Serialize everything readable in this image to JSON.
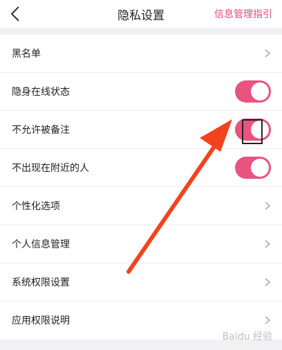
{
  "header": {
    "title": "隐私设置",
    "right_link": "信息管理指引"
  },
  "colors": {
    "accent": "#e9537f",
    "link": "#e3497f",
    "annotation_arrow": "#f2431e"
  },
  "settings": [
    {
      "label": "黑名单",
      "control": "chevron"
    },
    {
      "label": "隐身在线状态",
      "control": "toggle",
      "on": true
    },
    {
      "label": "不允许被备注",
      "control": "toggle",
      "on": true
    },
    {
      "label": "不出现在附近的人",
      "control": "toggle",
      "on": true
    },
    {
      "label": "个性化选项",
      "control": "chevron"
    },
    {
      "label": "个人信息管理",
      "control": "chevron"
    },
    {
      "label": "系统权限设置",
      "control": "chevron"
    },
    {
      "label": "应用权限说明",
      "control": "chevron"
    }
  ],
  "watermark": "Baidu 经验"
}
